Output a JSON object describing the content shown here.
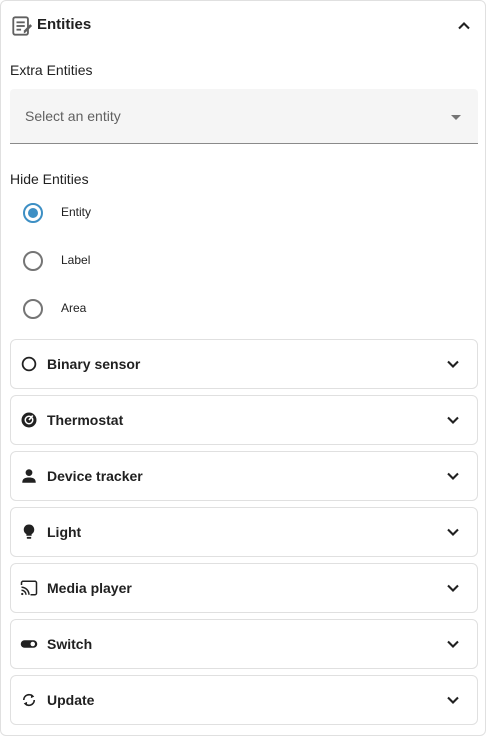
{
  "header": {
    "title": "Entities",
    "icon": "entities-icon"
  },
  "extra_entities": {
    "label": "Extra Entities",
    "placeholder": "Select an entity"
  },
  "hide_entities": {
    "label": "Hide Entities",
    "options": [
      {
        "label": "Entity",
        "checked": true
      },
      {
        "label": "Label",
        "checked": false
      },
      {
        "label": "Area",
        "checked": false
      }
    ]
  },
  "domains": [
    {
      "label": "Binary sensor",
      "icon": "circle-outline-icon"
    },
    {
      "label": "Thermostat",
      "icon": "thermostat-icon"
    },
    {
      "label": "Device tracker",
      "icon": "person-icon"
    },
    {
      "label": "Light",
      "icon": "lightbulb-icon"
    },
    {
      "label": "Media player",
      "icon": "cast-icon"
    },
    {
      "label": "Switch",
      "icon": "toggle-switch-icon"
    },
    {
      "label": "Update",
      "icon": "update-icon"
    }
  ],
  "colors": {
    "accent": "#3d8fc4",
    "text": "#212121",
    "border": "#e0e0e0"
  }
}
